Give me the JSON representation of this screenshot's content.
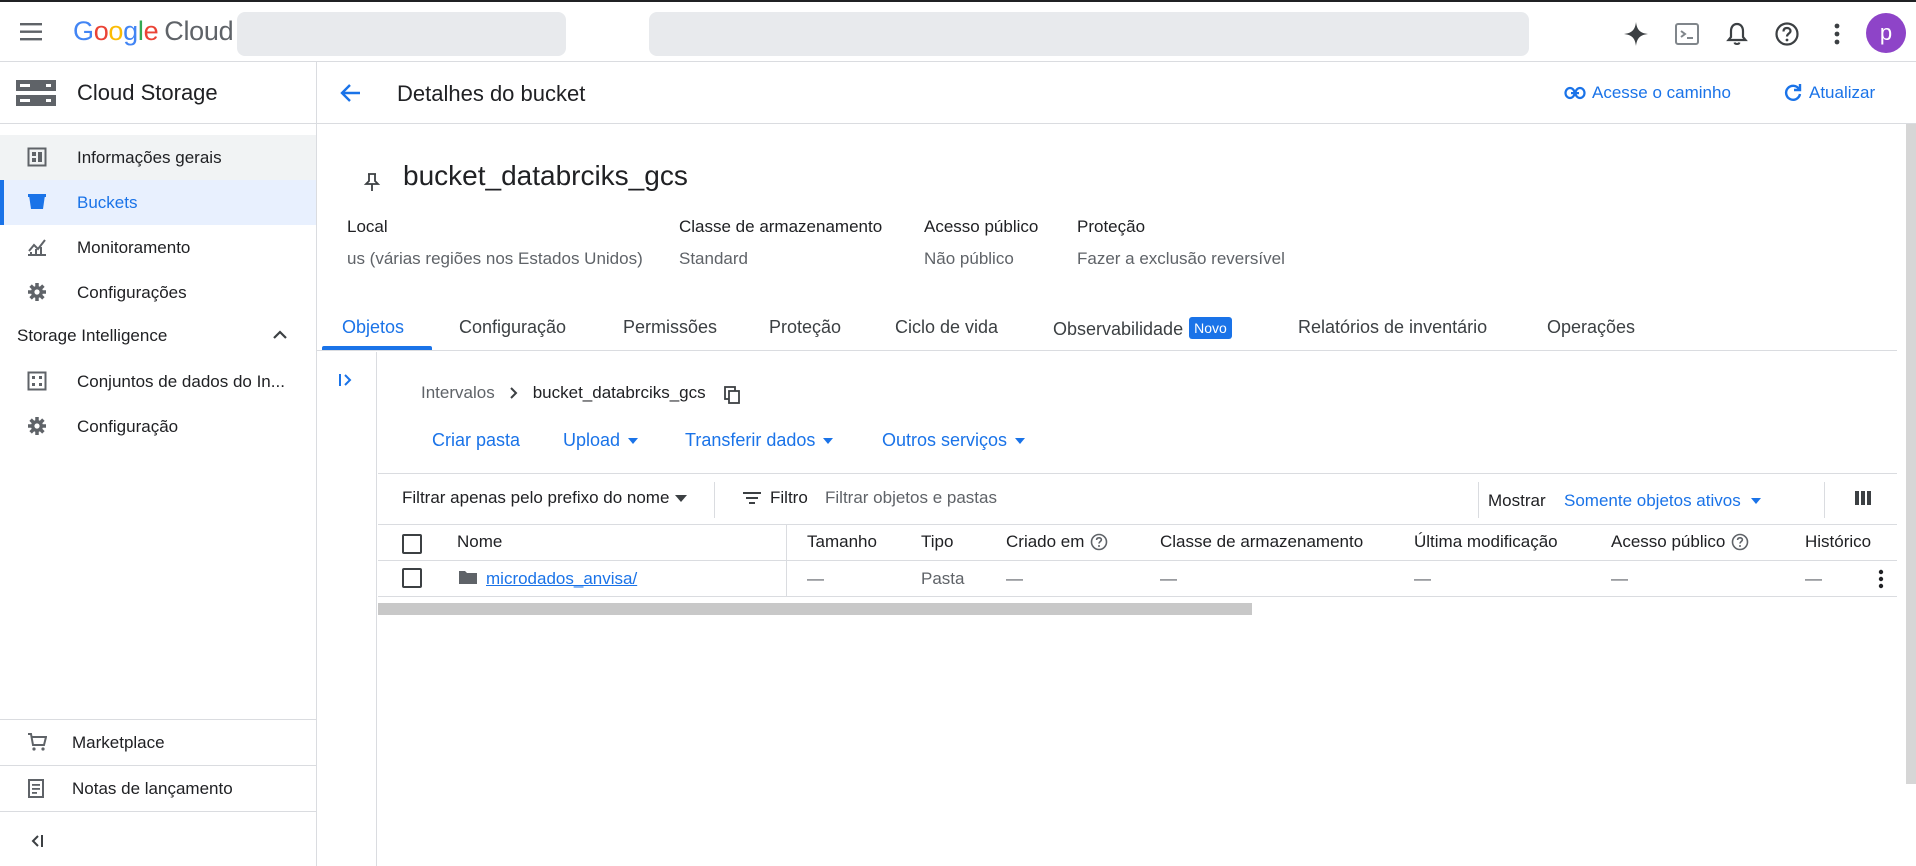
{
  "topbar": {
    "logo": {
      "google": "Google",
      "cloud": "Cloud"
    },
    "avatar_letter": "p"
  },
  "sidebar": {
    "product_title": "Cloud Storage",
    "items": [
      {
        "label": "Informações gerais"
      },
      {
        "label": "Buckets"
      },
      {
        "label": "Monitoramento"
      },
      {
        "label": "Configurações"
      }
    ],
    "section_title": "Storage Intelligence",
    "section_items": [
      {
        "label": "Conjuntos de dados do In..."
      },
      {
        "label": "Configuração"
      }
    ],
    "bottom_items": [
      {
        "label": "Marketplace"
      },
      {
        "label": "Notas de lançamento"
      }
    ]
  },
  "header": {
    "title": "Detalhes do bucket",
    "access_path": "Acesse o caminho",
    "refresh": "Atualizar"
  },
  "bucket": {
    "name": "bucket_databrciks_gcs",
    "meta": [
      {
        "key": "Local",
        "value": "us (várias regiões nos Estados Unidos)"
      },
      {
        "key": "Classe de armazenamento",
        "value": "Standard"
      },
      {
        "key": "Acesso público",
        "value": "Não público"
      },
      {
        "key": "Proteção",
        "value": "Fazer a exclusão reversível"
      }
    ]
  },
  "tabs": [
    {
      "label": "Objetos",
      "active": true
    },
    {
      "label": "Configuração"
    },
    {
      "label": "Permissões"
    },
    {
      "label": "Proteção"
    },
    {
      "label": "Ciclo de vida"
    },
    {
      "label": "Observabilidade",
      "badge": "Novo"
    },
    {
      "label": "Relatórios de inventário"
    },
    {
      "label": "Operações"
    }
  ],
  "breadcrumb": {
    "root": "Intervalos",
    "current": "bucket_databrciks_gcs"
  },
  "actions": {
    "create_folder": "Criar pasta",
    "upload": "Upload",
    "transfer": "Transferir dados",
    "other": "Outros serviços"
  },
  "filter": {
    "prefix_label": "Filtrar apenas pelo prefixo do nome",
    "filter_label": "Filtro",
    "placeholder": "Filtrar objetos e pastas",
    "show_label": "Mostrar",
    "show_value": "Somente objetos ativos"
  },
  "table": {
    "columns": [
      "Nome",
      "Tamanho",
      "Tipo",
      "Criado em",
      "Classe de armazenamento",
      "Última modificação",
      "Acesso público",
      "Histórico"
    ],
    "rows": [
      {
        "name": "microdados_anvisa/",
        "size": "—",
        "type": "Pasta",
        "created": "—",
        "storage_class": "—",
        "modified": "—",
        "public_access": "—",
        "history": "—"
      }
    ]
  },
  "colors": {
    "accent": "#1a73e8",
    "active_bg": "#e8f0fe",
    "text": "#202124",
    "muted": "#5f6368"
  }
}
